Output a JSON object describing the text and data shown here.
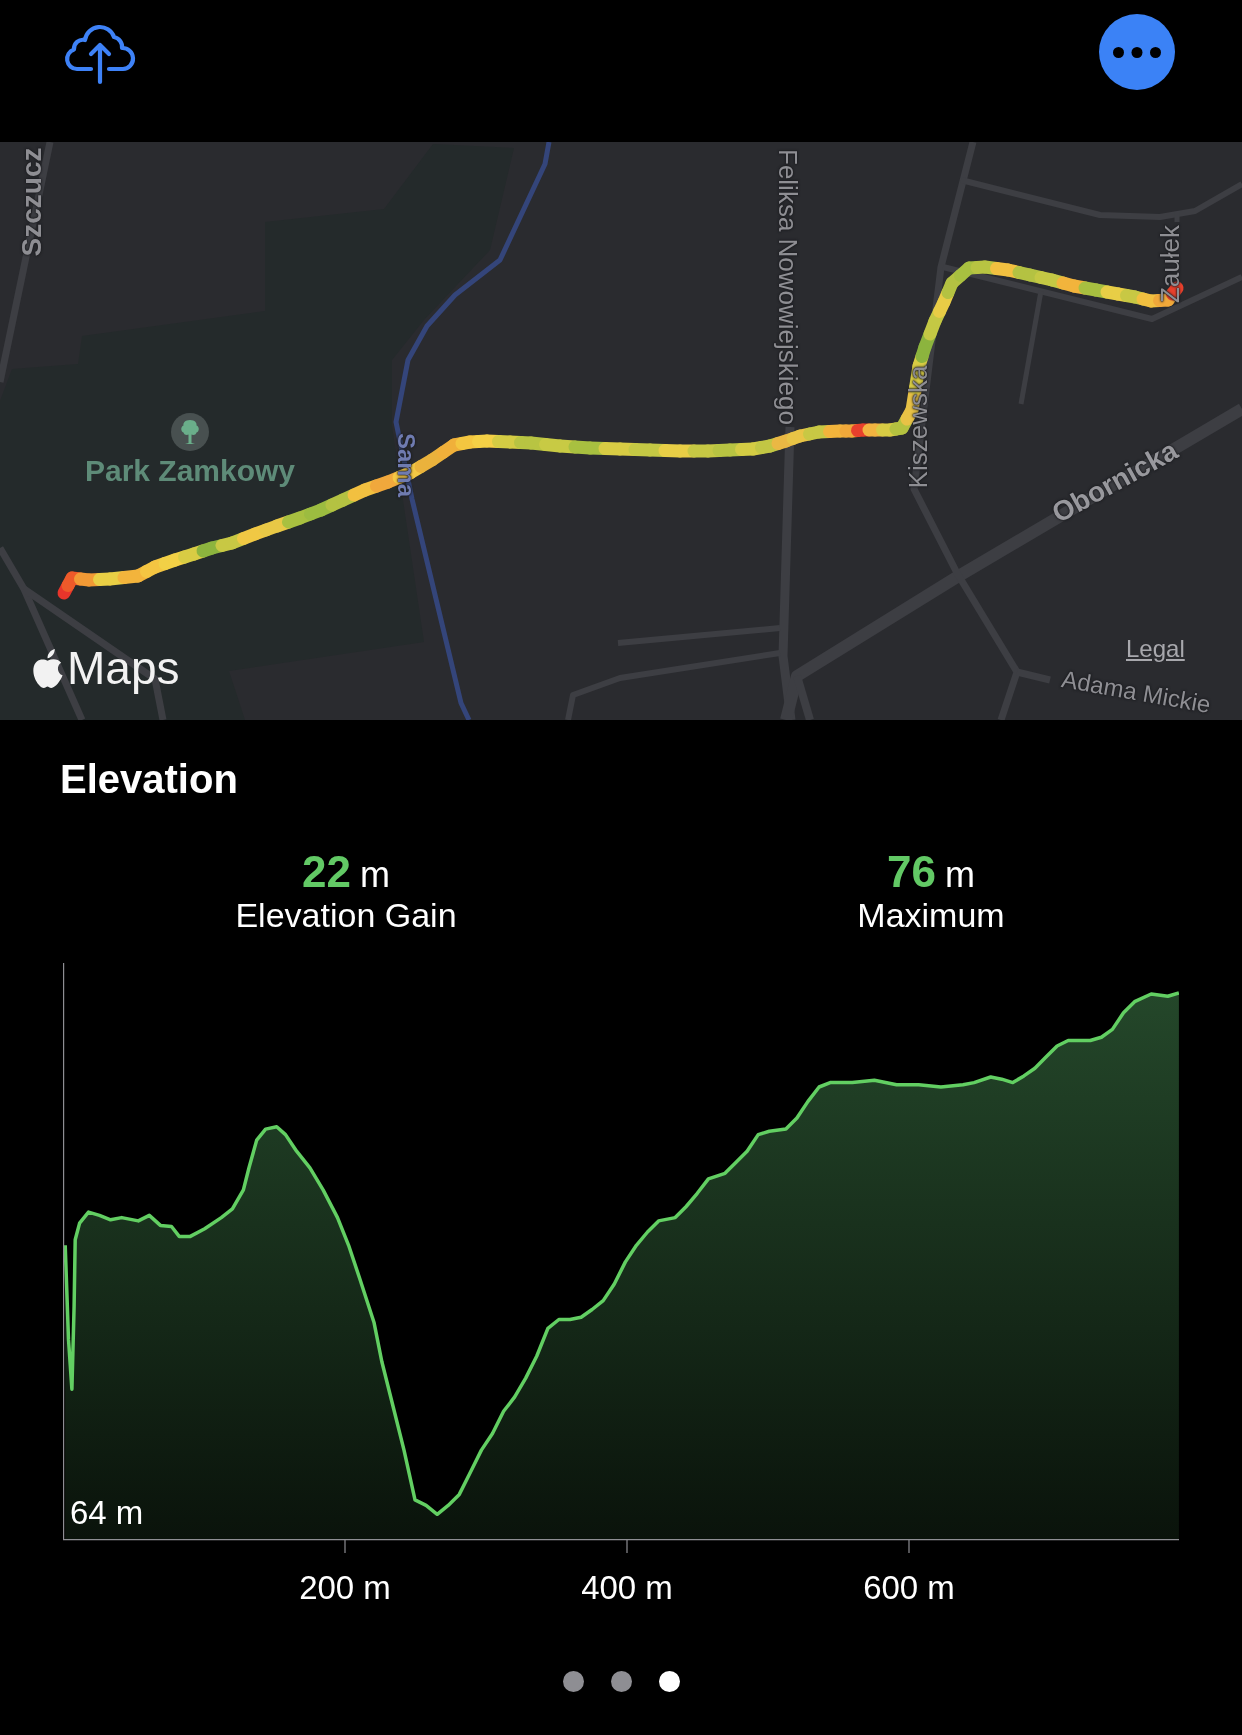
{
  "map": {
    "street_labels": [
      "Szczucz",
      "Feliksa Nowowiejskiego",
      "Kiszewska",
      "Zaułek",
      "Obornicka",
      "Adama Mickie"
    ],
    "river_label": "Sama",
    "park_label": "Park Zamkowy",
    "logo_text": "Maps",
    "legal_link": "Legal"
  },
  "elevation": {
    "title": "Elevation",
    "stats": [
      {
        "value": "22",
        "unit": "m",
        "label": "Elevation Gain"
      },
      {
        "value": "76",
        "unit": "m",
        "label": "Maximum"
      }
    ],
    "y_label": "64 m",
    "x_tick_labels": [
      "200 m",
      "400 m",
      "600 m"
    ]
  },
  "page_indicator": [
    {
      "selected": false
    },
    {
      "selected": false
    },
    {
      "selected": true
    }
  ]
}
